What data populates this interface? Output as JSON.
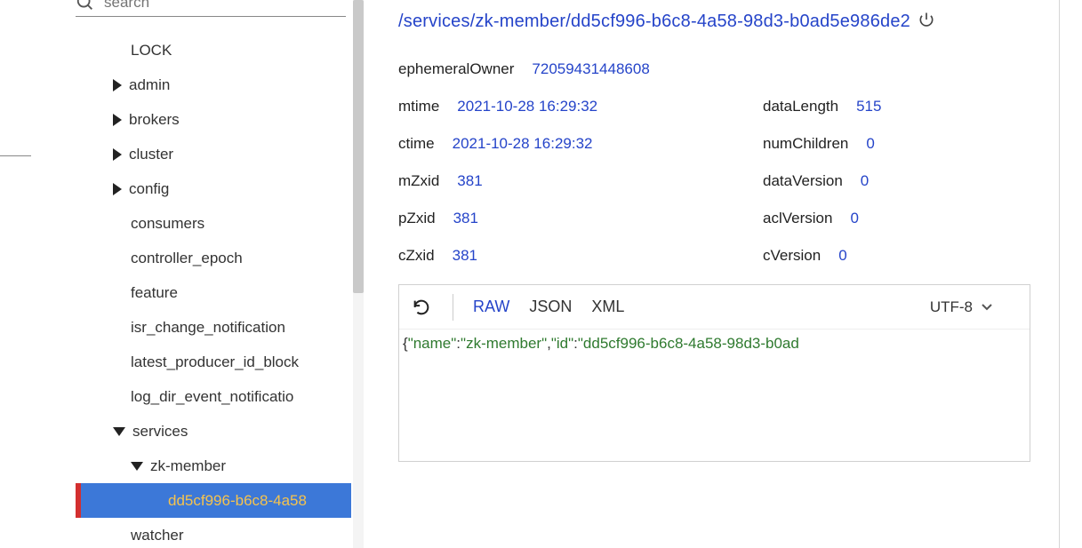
{
  "search": {
    "placeholder": "search",
    "value": ""
  },
  "tree": {
    "items": [
      {
        "label": "LOCK",
        "indent": 1,
        "caret": null,
        "selected": false
      },
      {
        "label": "admin",
        "indent": 1,
        "caret": "right",
        "selected": false
      },
      {
        "label": "brokers",
        "indent": 1,
        "caret": "right",
        "selected": false
      },
      {
        "label": "cluster",
        "indent": 1,
        "caret": "right",
        "selected": false
      },
      {
        "label": "config",
        "indent": 1,
        "caret": "right",
        "selected": false
      },
      {
        "label": "consumers",
        "indent": 1,
        "caret": null,
        "selected": false
      },
      {
        "label": "controller_epoch",
        "indent": 1,
        "caret": null,
        "selected": false
      },
      {
        "label": "feature",
        "indent": 1,
        "caret": null,
        "selected": false
      },
      {
        "label": "isr_change_notification",
        "indent": 1,
        "caret": null,
        "selected": false
      },
      {
        "label": "latest_producer_id_block",
        "indent": 1,
        "caret": null,
        "selected": false
      },
      {
        "label": "log_dir_event_notificatio",
        "indent": 1,
        "caret": null,
        "selected": false
      },
      {
        "label": "services",
        "indent": 1,
        "caret": "down",
        "selected": false
      },
      {
        "label": "zk-member",
        "indent": 2,
        "caret": "down",
        "selected": false
      },
      {
        "label": "dd5cf996-b6c8-4a58",
        "indent": 3,
        "caret": null,
        "selected": true
      },
      {
        "label": "watcher",
        "indent": 1,
        "caret": null,
        "selected": false
      }
    ]
  },
  "node": {
    "path": "/services/zk-member/dd5cf996-b6c8-4a58-98d3-b0ad5e986de2",
    "ephemeralOwner_label": "ephemeralOwner",
    "ephemeralOwner": "72059431448608",
    "mtime_label": "mtime",
    "mtime": "2021-10-28 16:29:32",
    "dataLength_label": "dataLength",
    "dataLength": "515",
    "ctime_label": "ctime",
    "ctime": "2021-10-28 16:29:32",
    "numChildren_label": "numChildren",
    "numChildren": "0",
    "mZxid_label": "mZxid",
    "mZxid": "381",
    "dataVersion_label": "dataVersion",
    "dataVersion": "0",
    "pZxid_label": "pZxid",
    "pZxid": "381",
    "aclVersion_label": "aclVersion",
    "aclVersion": "0",
    "cZxid_label": "cZxid",
    "cZxid": "381",
    "cVersion_label": "cVersion",
    "cVersion": "0"
  },
  "viewer": {
    "formats": {
      "raw": "RAW",
      "json": "JSON",
      "xml": "XML"
    },
    "active_format": "raw",
    "encoding": "UTF-8",
    "data_parts": {
      "p1": "{",
      "k1": "\"name\"",
      "c1": ":",
      "v1": "\"zk-member\"",
      "cm": ",",
      "k2": "\"id\"",
      "c2": ":",
      "v2": "\"dd5cf996-b6c8-4a58-98d3-b0ad"
    }
  }
}
